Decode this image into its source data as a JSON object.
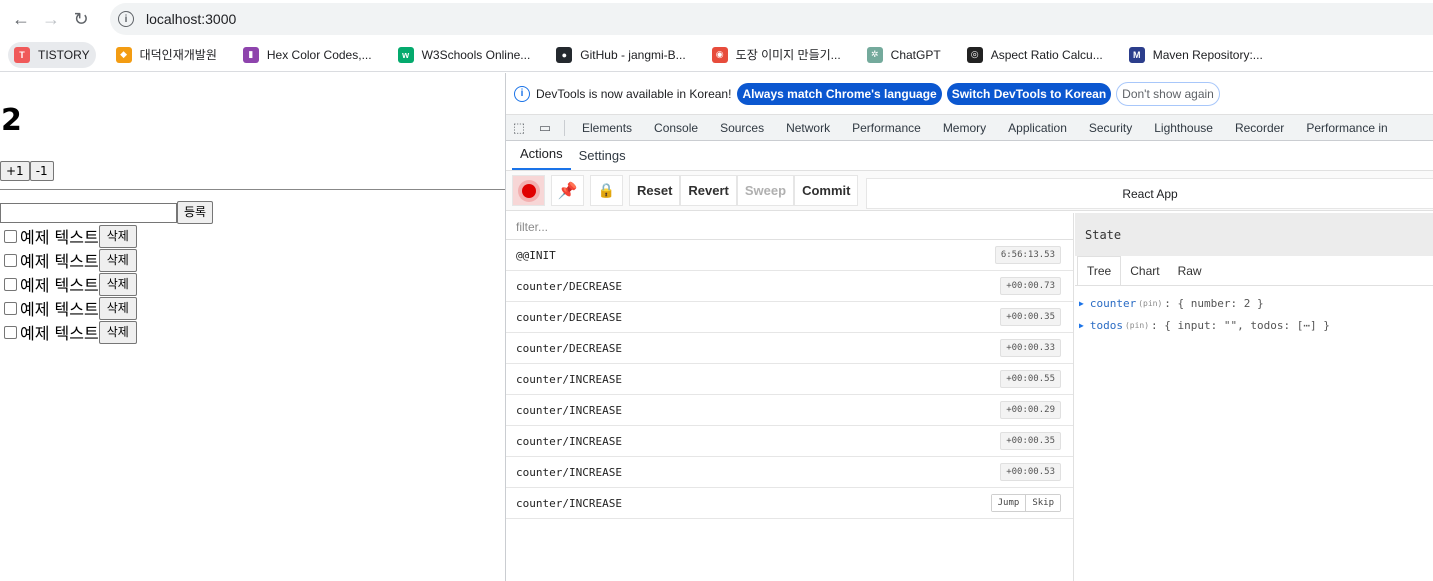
{
  "browser": {
    "url": "localhost:3000",
    "bookmarks": [
      {
        "label": "TISTORY",
        "color": "#f05a5a",
        "glyph": "T"
      },
      {
        "label": "대덕인재개발원",
        "color": "#f39c12",
        "glyph": "◆"
      },
      {
        "label": "Hex Color Codes,...",
        "color": "#8e44ad",
        "glyph": "▮"
      },
      {
        "label": "W3Schools Online...",
        "color": "#04aa6d",
        "glyph": "w"
      },
      {
        "label": "GitHub - jangmi-B...",
        "color": "#24292e",
        "glyph": "●"
      },
      {
        "label": "도장 이미지 만들기...",
        "color": "#e74c3c",
        "glyph": "◉"
      },
      {
        "label": "ChatGPT",
        "color": "#74aa9c",
        "glyph": "✲"
      },
      {
        "label": "Aspect Ratio Calcu...",
        "color": "#222222",
        "glyph": "◎"
      },
      {
        "label": "Maven Repository:...",
        "color": "#2c3e8c",
        "glyph": "M"
      }
    ]
  },
  "page": {
    "count": "2",
    "inc_label": "+1",
    "dec_label": "-1",
    "input_value": "",
    "add_label": "등록",
    "todos": [
      {
        "text": "예제 텍스트",
        "delete_label": "삭제"
      },
      {
        "text": "예제 텍스트",
        "delete_label": "삭제"
      },
      {
        "text": "예제 텍스트",
        "delete_label": "삭제"
      },
      {
        "text": "예제 텍스트",
        "delete_label": "삭제"
      },
      {
        "text": "예제 텍스트",
        "delete_label": "삭제"
      }
    ]
  },
  "devtools": {
    "infobar": {
      "message": "DevTools is now available in Korean!",
      "match_label": "Always match Chrome's language",
      "switch_label": "Switch DevTools to Korean",
      "dismiss_label": "Don't show again"
    },
    "tabs": [
      "Elements",
      "Console",
      "Sources",
      "Network",
      "Performance",
      "Memory",
      "Application",
      "Security",
      "Lighthouse",
      "Recorder",
      "Performance in"
    ],
    "subtabs": [
      "Actions",
      "Settings"
    ],
    "toolbar": {
      "reset": "Reset",
      "revert": "Revert",
      "sweep": "Sweep",
      "commit": "Commit",
      "instance": "React App"
    },
    "filter_placeholder": "filter...",
    "actions": [
      {
        "type": "@@INIT",
        "time": "6:56:13.53"
      },
      {
        "type": "counter/DECREASE",
        "time": "+00:00.73"
      },
      {
        "type": "counter/DECREASE",
        "time": "+00:00.35"
      },
      {
        "type": "counter/DECREASE",
        "time": "+00:00.33"
      },
      {
        "type": "counter/INCREASE",
        "time": "+00:00.55"
      },
      {
        "type": "counter/INCREASE",
        "time": "+00:00.29"
      },
      {
        "type": "counter/INCREASE",
        "time": "+00:00.35"
      },
      {
        "type": "counter/INCREASE",
        "time": "+00:00.53"
      },
      {
        "type": "counter/INCREASE",
        "jump": "Jump",
        "skip": "Skip"
      }
    ],
    "state": {
      "title": "State",
      "tabs": [
        "Tree",
        "Chart",
        "Raw"
      ],
      "tree": [
        {
          "key": "counter",
          "pin": "(pin)",
          "value": ": { number: 2 }"
        },
        {
          "key": "todos",
          "pin": "(pin)",
          "value": ": { input: \"\", todos: [⋯] }"
        }
      ]
    }
  }
}
